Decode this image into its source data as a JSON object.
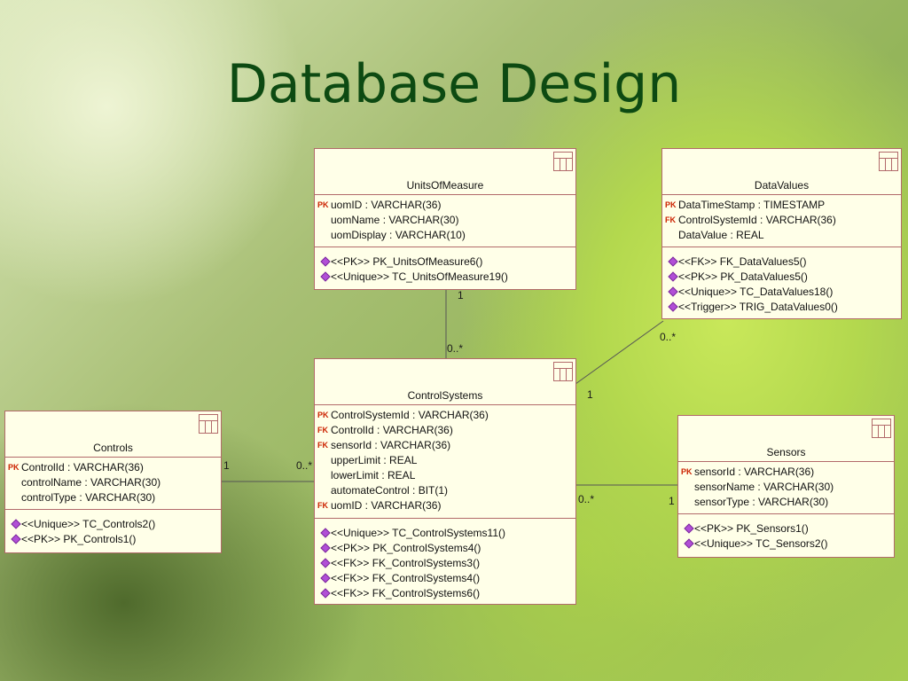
{
  "slide": {
    "title": "Database Design"
  },
  "colors": {
    "title": "#0d4a12",
    "box_fill": "#ffffe8",
    "box_border": "#b26a6a",
    "pk": "#cc2200",
    "method_icon": "#b14fd6"
  },
  "classes": {
    "units_of_measure": {
      "name": "UnitsOfMeasure",
      "attributes": [
        {
          "key": "PK",
          "text": "uomID : VARCHAR(36)"
        },
        {
          "key": "",
          "text": "uomName : VARCHAR(30)"
        },
        {
          "key": "",
          "text": "uomDisplay : VARCHAR(10)"
        }
      ],
      "operations": [
        "<<PK>> PK_UnitsOfMeasure6()",
        "<<Unique>> TC_UnitsOfMeasure19()"
      ]
    },
    "data_values": {
      "name": "DataValues",
      "attributes": [
        {
          "key": "PK",
          "text": "DataTimeStamp : TIMESTAMP"
        },
        {
          "key": "FK",
          "text": "ControlSystemId : VARCHAR(36)"
        },
        {
          "key": "",
          "text": "DataValue : REAL"
        }
      ],
      "operations": [
        "<<FK>> FK_DataValues5()",
        "<<PK>> PK_DataValues5()",
        "<<Unique>> TC_DataValues18()",
        "<<Trigger>> TRIG_DataValues0()"
      ]
    },
    "control_systems": {
      "name": "ControlSystems",
      "attributes": [
        {
          "key": "PK",
          "text": "ControlSystemId : VARCHAR(36)"
        },
        {
          "key": "FK",
          "text": "ControlId : VARCHAR(36)"
        },
        {
          "key": "FK",
          "text": "sensorId : VARCHAR(36)"
        },
        {
          "key": "",
          "text": "upperLimit : REAL"
        },
        {
          "key": "",
          "text": "lowerLimit : REAL"
        },
        {
          "key": "",
          "text": "automateControl : BIT(1)"
        },
        {
          "key": "FK",
          "text": "uomID : VARCHAR(36)"
        }
      ],
      "operations": [
        "<<Unique>> TC_ControlSystems11()",
        "<<PK>> PK_ControlSystems4()",
        "<<FK>> FK_ControlSystems3()",
        "<<FK>> FK_ControlSystems4()",
        "<<FK>> FK_ControlSystems6()"
      ]
    },
    "controls": {
      "name": "Controls",
      "attributes": [
        {
          "key": "PK",
          "text": "ControlId : VARCHAR(36)"
        },
        {
          "key": "",
          "text": "controlName : VARCHAR(30)"
        },
        {
          "key": "",
          "text": "controlType : VARCHAR(30)"
        }
      ],
      "operations": [
        "<<Unique>> TC_Controls2()",
        "<<PK>> PK_Controls1()"
      ]
    },
    "sensors": {
      "name": "Sensors",
      "attributes": [
        {
          "key": "PK",
          "text": "sensorId : VARCHAR(36)"
        },
        {
          "key": "",
          "text": "sensorName : VARCHAR(30)"
        },
        {
          "key": "",
          "text": "sensorType : VARCHAR(30)"
        }
      ],
      "operations": [
        "<<PK>> PK_Sensors1()",
        "<<Unique>> TC_Sensors2()"
      ]
    }
  },
  "multiplicities": {
    "uom_one": "1",
    "uom_many": "0..*",
    "dv_many": "0..*",
    "dv_one": "1",
    "ctrl_one": "1",
    "ctrl_many": "0..*",
    "sens_many": "0..*",
    "sens_one": "1"
  }
}
